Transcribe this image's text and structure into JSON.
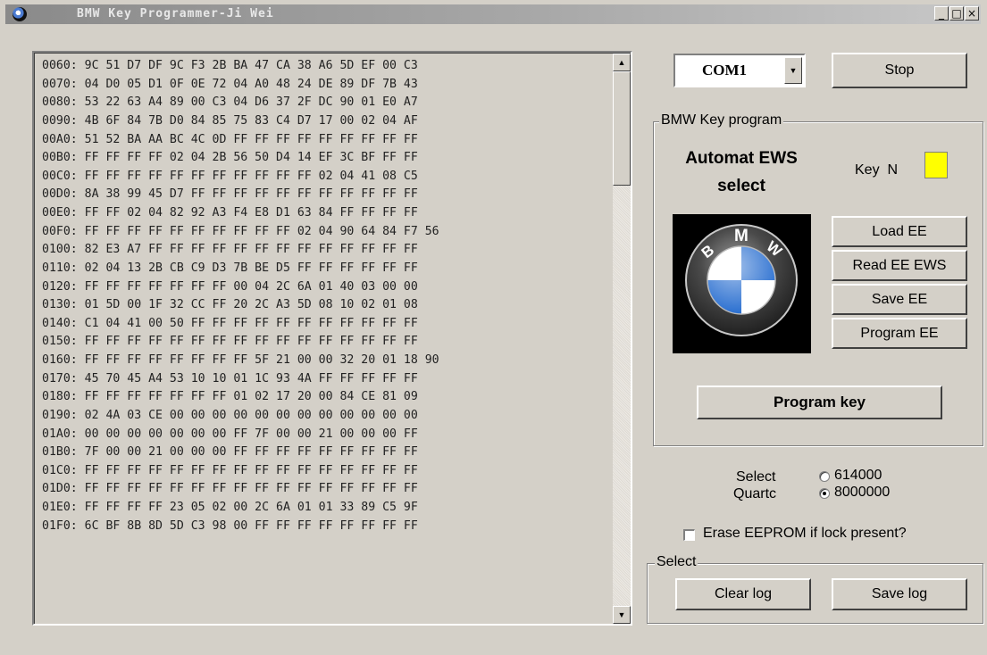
{
  "window": {
    "title": "BMW Key Programmer-Ji Wei",
    "minimize": "_",
    "maximize": "□",
    "close": "×"
  },
  "hex_dump": [
    "0060: 9C 51 D7 DF 9C F3 2B BA 47 CA 38 A6 5D EF 00 C3",
    "0070: 04 D0 05 D1 0F 0E 72 04 A0 48 24 DE 89 DF 7B 43",
    "0080: 53 22 63 A4 89 00 C3 04 D6 37 2F DC 90 01 E0 A7",
    "0090: 4B 6F 84 7B D0 84 85 75 83 C4 D7 17 00 02 04 AF",
    "00A0: 51 52 BA AA BC 4C 0D FF FF FF FF FF FF FF FF FF",
    "00B0: FF FF FF FF 02 04 2B 56 50 D4 14 EF 3C BF FF FF",
    "00C0: FF FF FF FF FF FF FF FF FF FF FF 02 04 41 08 C5",
    "00D0: 8A 38 99 45 D7 FF FF FF FF FF FF FF FF FF FF FF",
    "00E0: FF FF 02 04 82 92 A3 F4 E8 D1 63 84 FF FF FF FF",
    "00F0: FF FF FF FF FF FF FF FF FF FF 02 04 90 64 84 F7 56",
    "0100: 82 E3 A7 FF FF FF FF FF FF FF FF FF FF FF FF FF",
    "0110: 02 04 13 2B CB C9 D3 7B BE D5 FF FF FF FF FF FF",
    "0120: FF FF FF FF FF FF FF 00 04 2C 6A 01 40 03 00 00",
    "0130: 01 5D 00 1F 32 CC FF 20 2C A3 5D 08 10 02 01 08",
    "0140: C1 04 41 00 50 FF FF FF FF FF FF FF FF FF FF FF",
    "0150: FF FF FF FF FF FF FF FF FF FF FF FF FF FF FF FF",
    "0160: FF FF FF FF FF FF FF FF 5F 21 00 00 32 20 01 18 90",
    "0170: 45 70 45 A4 53 10 10 01 1C 93 4A FF FF FF FF FF",
    "0180: FF FF FF FF FF FF FF 01 02 17 20 00 84 CE 81 09",
    "0190: 02 4A 03 CE 00 00 00 00 00 00 00 00 00 00 00 00",
    "01A0: 00 00 00 00 00 00 00 FF 7F 00 00 21 00 00 00 FF",
    "01B0: 7F 00 00 21 00 00 00 FF FF FF FF FF FF FF FF FF",
    "01C0: FF FF FF FF FF FF FF FF FF FF FF FF FF FF FF FF",
    "01D0: FF FF FF FF FF FF FF FF FF FF FF FF FF FF FF FF",
    "01E0: FF FF FF FF 23 05 02 00 2C 6A 01 01 33 89 C5 9F",
    "01F0: 6C BF 8B 8D 5D C3 98 00 FF FF FF FF FF FF FF FF"
  ],
  "port": {
    "value": "COM1"
  },
  "stop_label": "Stop",
  "key_program": {
    "group_label": "BMW Key program",
    "automat_line1": "Automat EWS",
    "automat_line2": "select",
    "key_label": "Key  N",
    "key_indicator_color": "#ffff00",
    "load_ee": "Load EE",
    "read_ee_ews": "Read EE EWS",
    "save_ee": "Save EE",
    "program_ee": "Program EE",
    "program_key": "Program key",
    "logo_letters": [
      "B",
      "M",
      "W"
    ]
  },
  "quartz": {
    "label_line1": "Select",
    "label_line2": "Quartc",
    "options": [
      {
        "label": "614000",
        "checked": false
      },
      {
        "label": "8000000",
        "checked": true
      }
    ]
  },
  "erase": {
    "label": "Erase EEPROM if lock present?",
    "checked": false
  },
  "log": {
    "group_label": "Select",
    "clear_log": "Clear log",
    "save_log": "Save log"
  }
}
